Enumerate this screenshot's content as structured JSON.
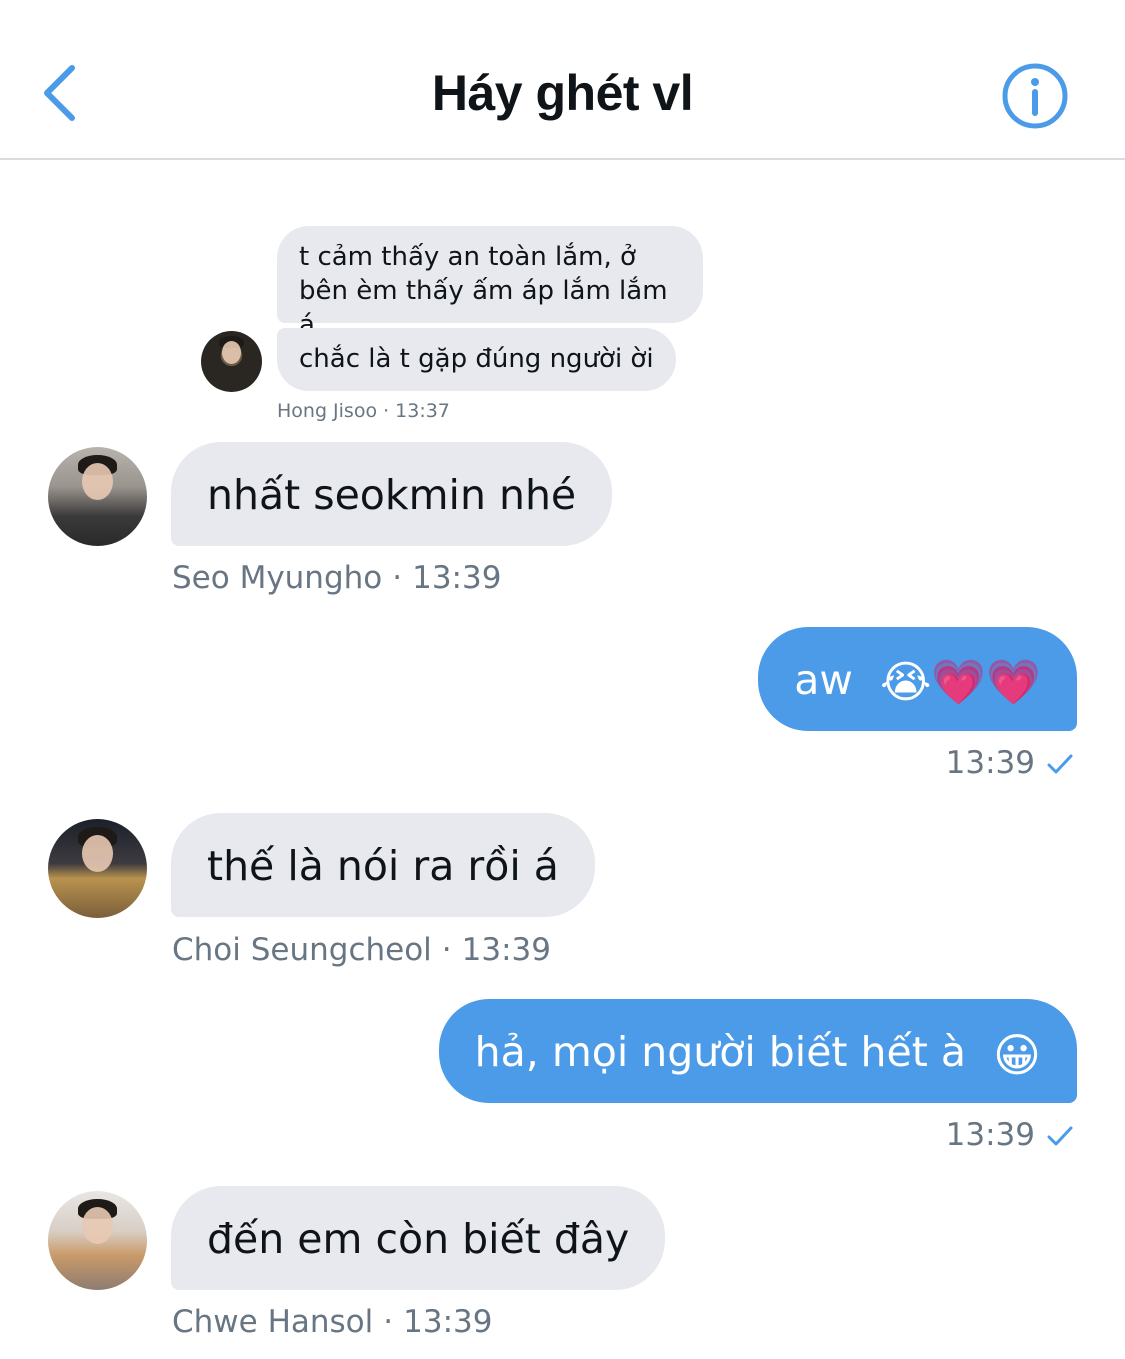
{
  "header": {
    "title": "Háy ghét vl",
    "back_icon": "chevron-left-icon",
    "info_icon": "info-circle-icon",
    "accent_color": "#4b9be8"
  },
  "messages": [
    {
      "direction": "in",
      "text": "t cảm thấy an toàn lắm, ở bên èm thấy ấm áp lắm lắm á"
    },
    {
      "direction": "in",
      "text": "chắc là t gặp đúng người ời",
      "sender": "Hong Jisoo",
      "time": "13:37"
    },
    {
      "direction": "in",
      "text": "nhất seokmin nhé",
      "sender": "Seo Myungho",
      "time": "13:39"
    },
    {
      "direction": "out",
      "text": "aw",
      "emoji": "😭💗💗",
      "time": "13:39",
      "status_icon": "checkmark-icon"
    },
    {
      "direction": "in",
      "text": "thế là nói ra rồi á",
      "sender": "Choi Seungcheol",
      "time": "13:39"
    },
    {
      "direction": "out",
      "text": "hả, mọi người biết hết à",
      "emoji": "😀",
      "time": "13:39",
      "status_icon": "checkmark-icon"
    },
    {
      "direction": "in",
      "text": "đến em còn biết đây",
      "sender": "Chwe Hansol",
      "time": "13:39"
    }
  ],
  "separator": "·",
  "colors": {
    "incoming_bubble": "#e7e9ee",
    "outgoing_bubble": "#4b9be8",
    "meta_text": "#687684"
  }
}
